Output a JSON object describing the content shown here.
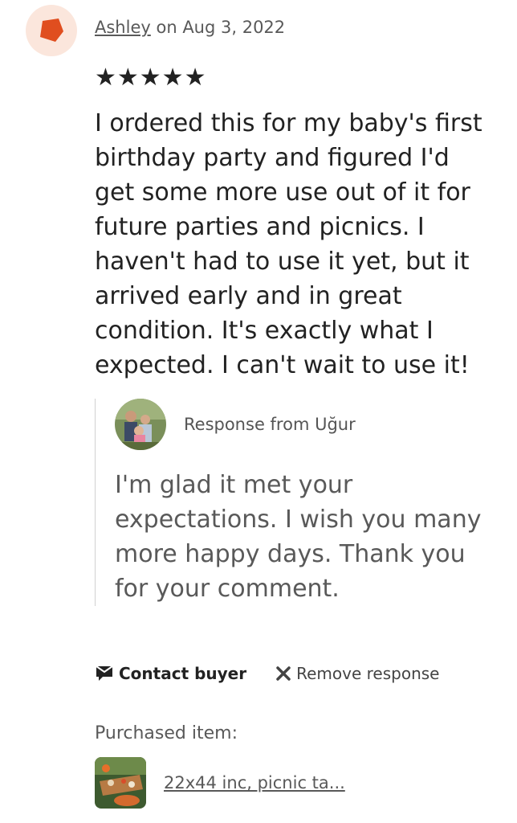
{
  "review": {
    "reviewer_name": "Ashley",
    "date_text": " on Aug 3, 2022",
    "stars_text": "★★★★★",
    "rating": 5,
    "rating_max": 5,
    "text": "I ordered this for my baby's first birthday party and figured I'd get some more use out of it for future parties and picnics. I haven't had to use it yet, but it arrived early and in great condition. It's exactly what I expected. I can't wait to use it!"
  },
  "response": {
    "label": "Response from Uğur",
    "text": "I'm glad it met your expectations. I wish you many more happy days. Thank you for your comment."
  },
  "actions": {
    "contact_label": "Contact buyer",
    "remove_label": "Remove response"
  },
  "purchased": {
    "label": "Purchased item:",
    "item_title": "22x44 inc, picnic ta..."
  },
  "colors": {
    "reviewer_avatar_bg": "#fbe6dc",
    "reviewer_avatar_shape": "#e04e1f"
  }
}
